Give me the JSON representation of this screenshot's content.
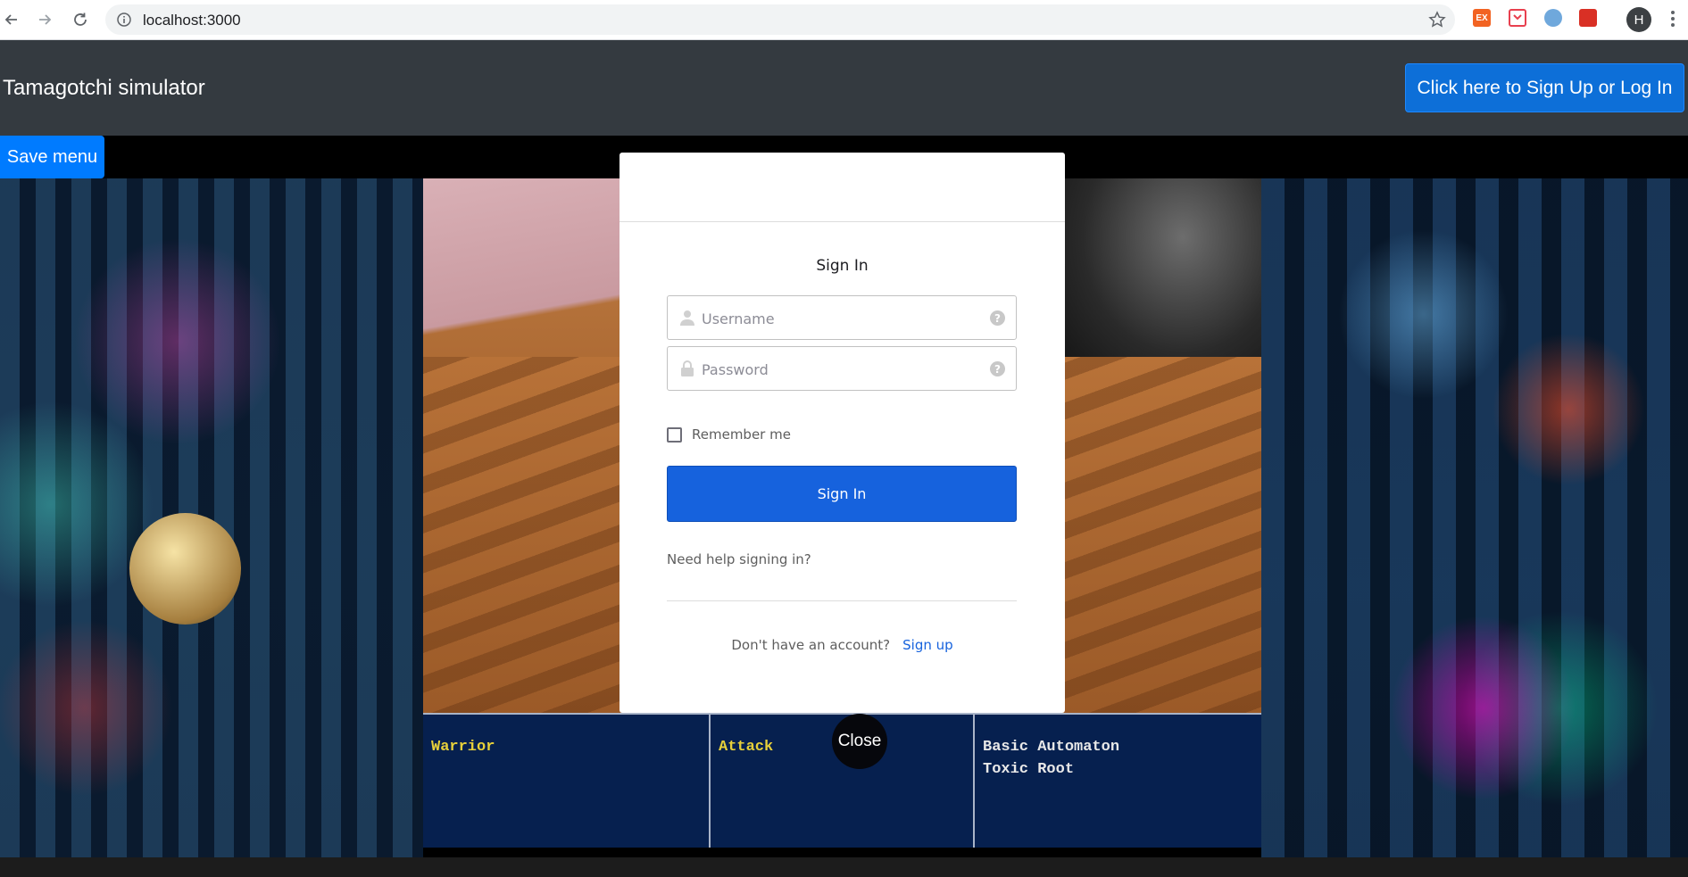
{
  "browser": {
    "url": "localhost:3000",
    "profile_initial": "H",
    "extensions": [
      {
        "name": "extension-ex-icon",
        "label": "EX",
        "color": "#f26322"
      },
      {
        "name": "pocket-icon",
        "label": "",
        "color": "#e8404f"
      },
      {
        "name": "extension-swirl-icon",
        "label": "",
        "color": "#6fa8dc"
      },
      {
        "name": "extension-red-icon",
        "label": "",
        "color": "#d93025"
      }
    ]
  },
  "navbar": {
    "brand": "Tamagotchi simulator",
    "auth_button": "Click here to Sign Up or Log In"
  },
  "save_menu": "Save menu",
  "stats": {
    "columns": [
      {
        "text": "Warrior",
        "style": "yellow"
      },
      {
        "text": "Attack",
        "style": "yellow"
      },
      {
        "text": "Basic Automaton\nToxic Root",
        "style": "white"
      }
    ],
    "close_label": "Close"
  },
  "login": {
    "title": "Sign In",
    "username_placeholder": "Username",
    "password_placeholder": "Password",
    "remember_label": "Remember me",
    "remember_checked": false,
    "submit_label": "Sign In",
    "help_link": "Need help signing in?",
    "no_account_text": "Don't have an account?",
    "signup_link": "Sign up"
  }
}
